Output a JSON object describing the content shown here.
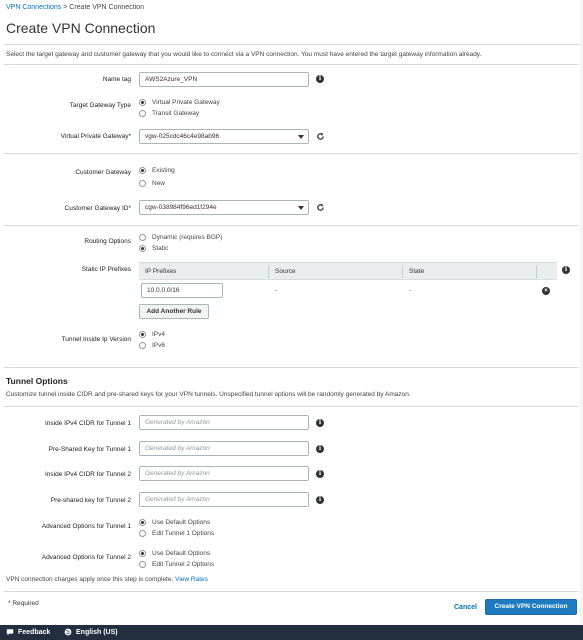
{
  "breadcrumb": {
    "parent": "VPN Connections",
    "separator": ">",
    "current": "Create VPN Connection"
  },
  "page_title": "Create VPN Connection",
  "intro": "Select the target gateway and customer gateway that you would like to connect via a VPN connection. You must have entered the target gateway information already.",
  "name_tag": {
    "label": "Name tag",
    "value": "AWS2Azure_VPN"
  },
  "target_gateway_type": {
    "label": "Target Gateway Type",
    "options": [
      "Virtual Private Gateway",
      "Transit Gateway"
    ],
    "selected": 0
  },
  "virtual_private_gateway": {
    "label": "Virtual Private Gateway*",
    "value": "vgw-025cdc46c4e98ab96"
  },
  "customer_gateway": {
    "label": "Customer Gateway",
    "options": [
      "Existing",
      "New"
    ],
    "selected": 0
  },
  "customer_gateway_id": {
    "label": "Customer Gateway ID*",
    "value": "cgw-038984f96ed1f294e"
  },
  "routing_options": {
    "label": "Routing Options",
    "options": [
      "Dynamic (requires BGP)",
      "Static"
    ],
    "selected": 1
  },
  "static_ip_prefixes": {
    "label": "Static IP Prefixes",
    "columns": [
      "IP Prefixes",
      "Source",
      "State"
    ],
    "rows": [
      {
        "prefix": "10.0.0.0/16",
        "source": "-",
        "state": "-"
      }
    ],
    "add_button": "Add Another Rule"
  },
  "tunnel_inside_ip_version": {
    "label": "Tunnel Inside Ip Version",
    "options": [
      "IPv4",
      "IPv6"
    ],
    "selected": 0
  },
  "tunnel_options": {
    "title": "Tunnel Options",
    "description": "Customize tunnel inside CIDR and pre-shared keys for your VPN tunnels. Unspecified tunnel options will be randomly generated by Amazon.",
    "fields": [
      {
        "label": "Inside IPv4 CIDR for Tunnel 1",
        "placeholder": "Generated by Amazon"
      },
      {
        "label": "Pre-Shared Key for Tunnel 1",
        "placeholder": "Generated by Amazon"
      },
      {
        "label": "Inside IPv4 CIDR for Tunnel 2",
        "placeholder": "Generated by Amazon"
      },
      {
        "label": "Pre-shared key for Tunnel 2",
        "placeholder": "Generated by Amazon"
      }
    ],
    "advanced": [
      {
        "label": "Advanced Options for Tunnel 1",
        "options": [
          "Use Default Options",
          "Edit Tunnel 1 Options"
        ],
        "selected": 0
      },
      {
        "label": "Advanced Options for Tunnel 2",
        "options": [
          "Use Default Options",
          "Edit Tunnel 2 Options"
        ],
        "selected": 0
      }
    ]
  },
  "charges_note": {
    "text": "VPN connection charges apply once this step is complete.",
    "link": "View Rates"
  },
  "required_note": "* Required",
  "actions": {
    "cancel": "Cancel",
    "create": "Create VPN Connection"
  },
  "footer": {
    "feedback": "Feedback",
    "language": "English (US)"
  },
  "icons": {
    "info": "info-icon",
    "refresh": "refresh-icon",
    "remove": "remove-icon",
    "dropdown": "chevron-down-icon",
    "feedback": "speech-bubble-icon",
    "language": "globe-icon"
  },
  "colors": {
    "link": "#0073bb",
    "primary": "#1f7bc1",
    "footer_bg": "#232f3e",
    "table_header": "#eaeded"
  }
}
